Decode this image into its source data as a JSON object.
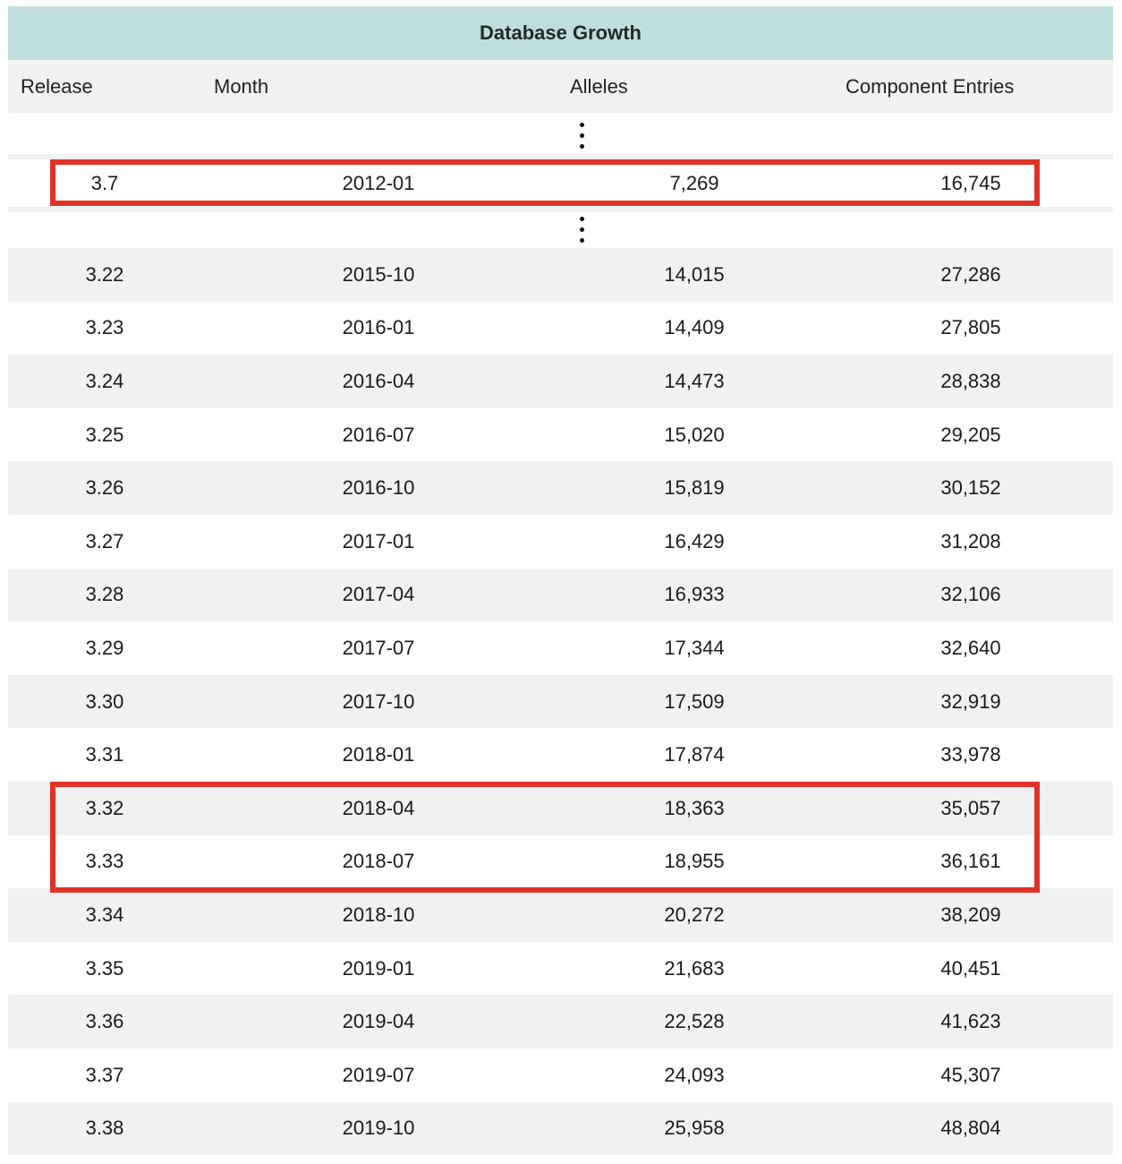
{
  "title": "Database Growth",
  "columns": {
    "release": "Release",
    "month": "Month",
    "alleles": "Alleles",
    "entries": "Component Entries"
  },
  "ellipsis": "⋮",
  "top_row": {
    "release": "3.7",
    "month": "2012-01",
    "alleles": "7,269",
    "entries": "16,745"
  },
  "rows": [
    {
      "release": "3.22",
      "month": "2015-10",
      "alleles": "14,015",
      "entries": "27,286"
    },
    {
      "release": "3.23",
      "month": "2016-01",
      "alleles": "14,409",
      "entries": "27,805"
    },
    {
      "release": "3.24",
      "month": "2016-04",
      "alleles": "14,473",
      "entries": "28,838"
    },
    {
      "release": "3.25",
      "month": "2016-07",
      "alleles": "15,020",
      "entries": "29,205"
    },
    {
      "release": "3.26",
      "month": "2016-10",
      "alleles": "15,819",
      "entries": "30,152"
    },
    {
      "release": "3.27",
      "month": "2017-01",
      "alleles": "16,429",
      "entries": "31,208"
    },
    {
      "release": "3.28",
      "month": "2017-04",
      "alleles": "16,933",
      "entries": "32,106"
    },
    {
      "release": "3.29",
      "month": "2017-07",
      "alleles": "17,344",
      "entries": "32,640"
    },
    {
      "release": "3.30",
      "month": "2017-10",
      "alleles": "17,509",
      "entries": "32,919"
    },
    {
      "release": "3.31",
      "month": "2018-01",
      "alleles": "17,874",
      "entries": "33,978"
    },
    {
      "release": "3.32",
      "month": "2018-04",
      "alleles": "18,363",
      "entries": "35,057"
    },
    {
      "release": "3.33",
      "month": "2018-07",
      "alleles": "18,955",
      "entries": "36,161"
    },
    {
      "release": "3.34",
      "month": "2018-10",
      "alleles": "20,272",
      "entries": "38,209"
    },
    {
      "release": "3.35",
      "month": "2019-01",
      "alleles": "21,683",
      "entries": "40,451"
    },
    {
      "release": "3.36",
      "month": "2019-04",
      "alleles": "22,528",
      "entries": "41,623"
    },
    {
      "release": "3.37",
      "month": "2019-07",
      "alleles": "24,093",
      "entries": "45,307"
    },
    {
      "release": "3.38",
      "month": "2019-10",
      "alleles": "25,958",
      "entries": "48,804"
    }
  ],
  "highlight_color": "#e03227",
  "header_color": "#bfdedd",
  "stripe_color": "#f1f1f1"
}
